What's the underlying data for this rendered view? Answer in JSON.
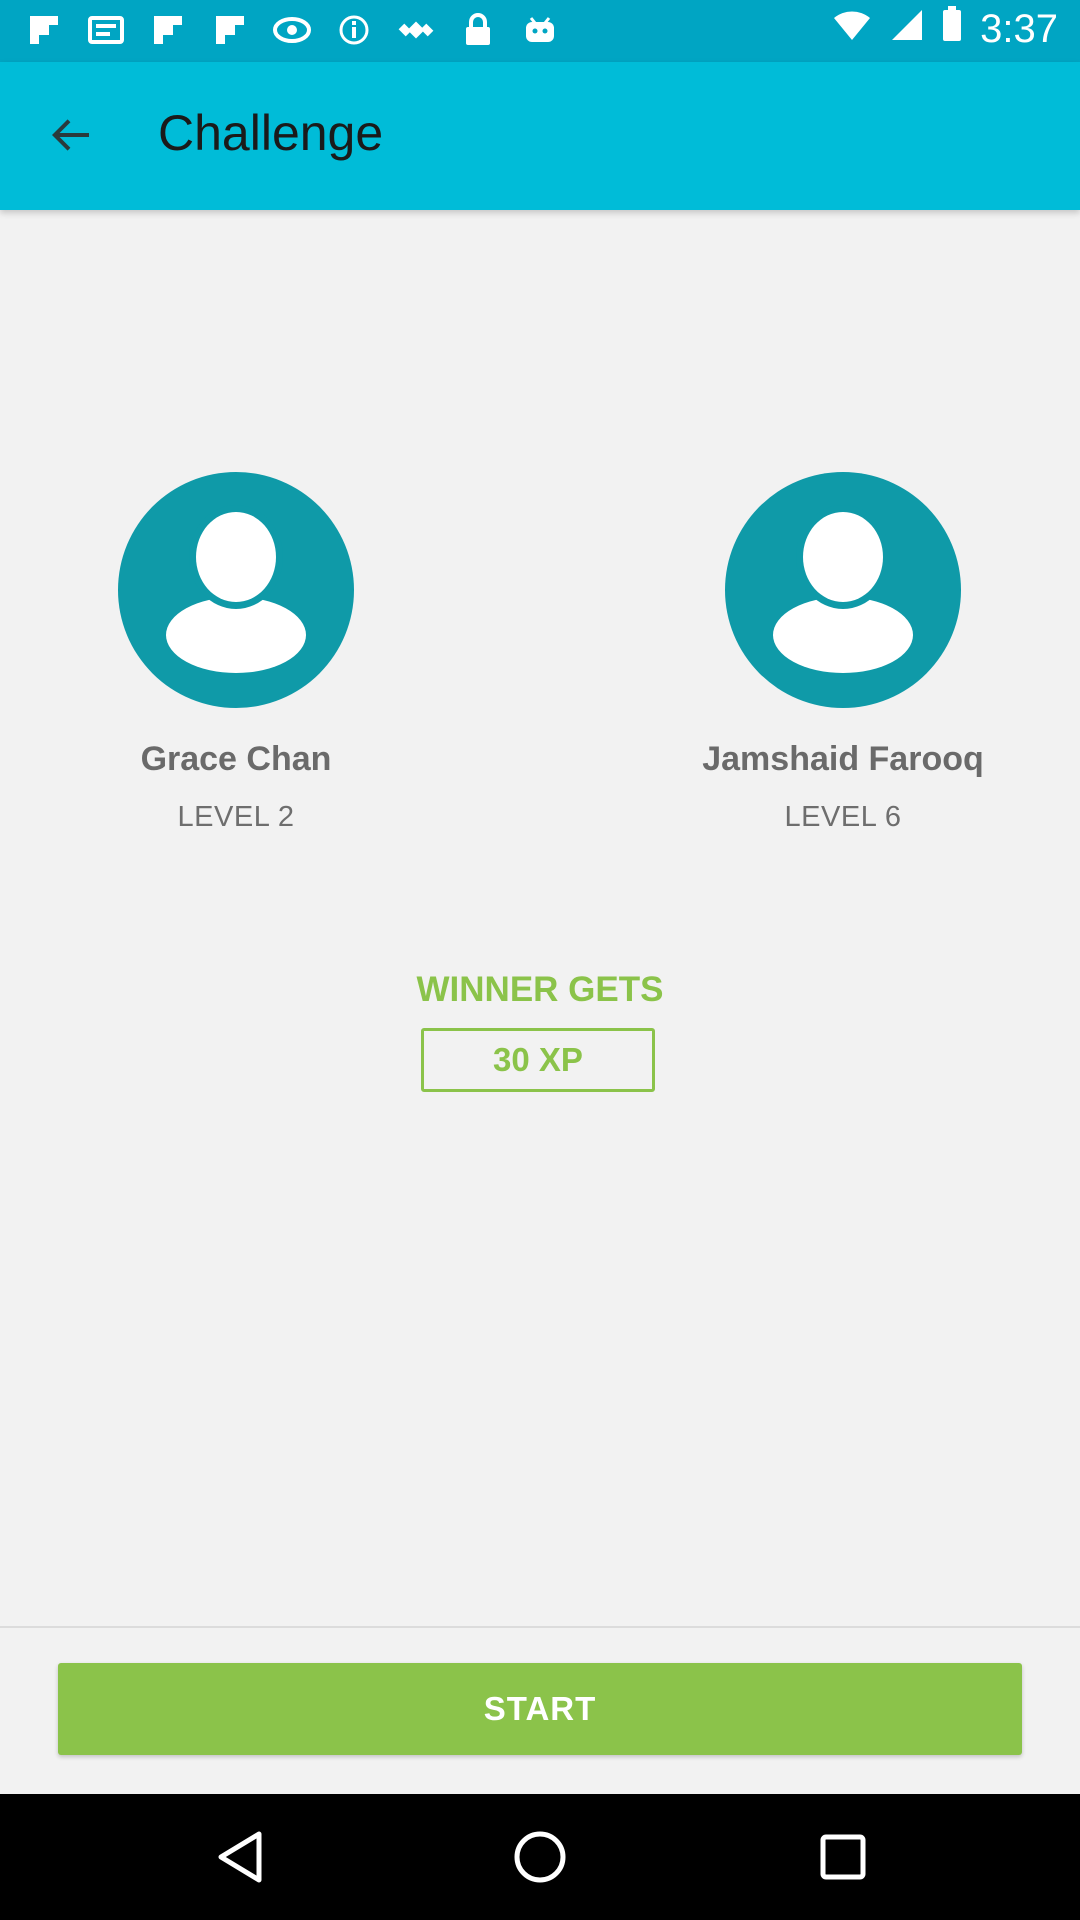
{
  "status_bar": {
    "time": "3:37",
    "left_icons": [
      "flipboard-icon",
      "news-icon",
      "flipboard-icon",
      "flipboard-icon",
      "eye-icon",
      "info-icon",
      "fake-gps-icon",
      "lock-icon",
      "android-icon"
    ],
    "right_icons": [
      "wifi-icon",
      "signal-icon",
      "battery-icon"
    ]
  },
  "app_bar": {
    "title": "Challenge",
    "back_icon": "arrow-back-icon"
  },
  "players": [
    {
      "name": "Grace Chan",
      "level": "LEVEL 2",
      "avatar_icon": "person-icon"
    },
    {
      "name": "Jamshaid Farooq",
      "level": "LEVEL 6",
      "avatar_icon": "person-icon"
    }
  ],
  "reward": {
    "label": "WINNER GETS",
    "value": "30 XP"
  },
  "actions": {
    "start_label": "START"
  },
  "nav_bar": {
    "buttons": [
      "back-triangle-icon",
      "home-circle-icon",
      "recents-square-icon"
    ]
  },
  "colors": {
    "status_bar": "#00a5c3",
    "app_bar": "#00bcd8",
    "avatar": "#0f9aa8",
    "accent_green": "#8bc34a",
    "background": "#f2f2f2"
  }
}
